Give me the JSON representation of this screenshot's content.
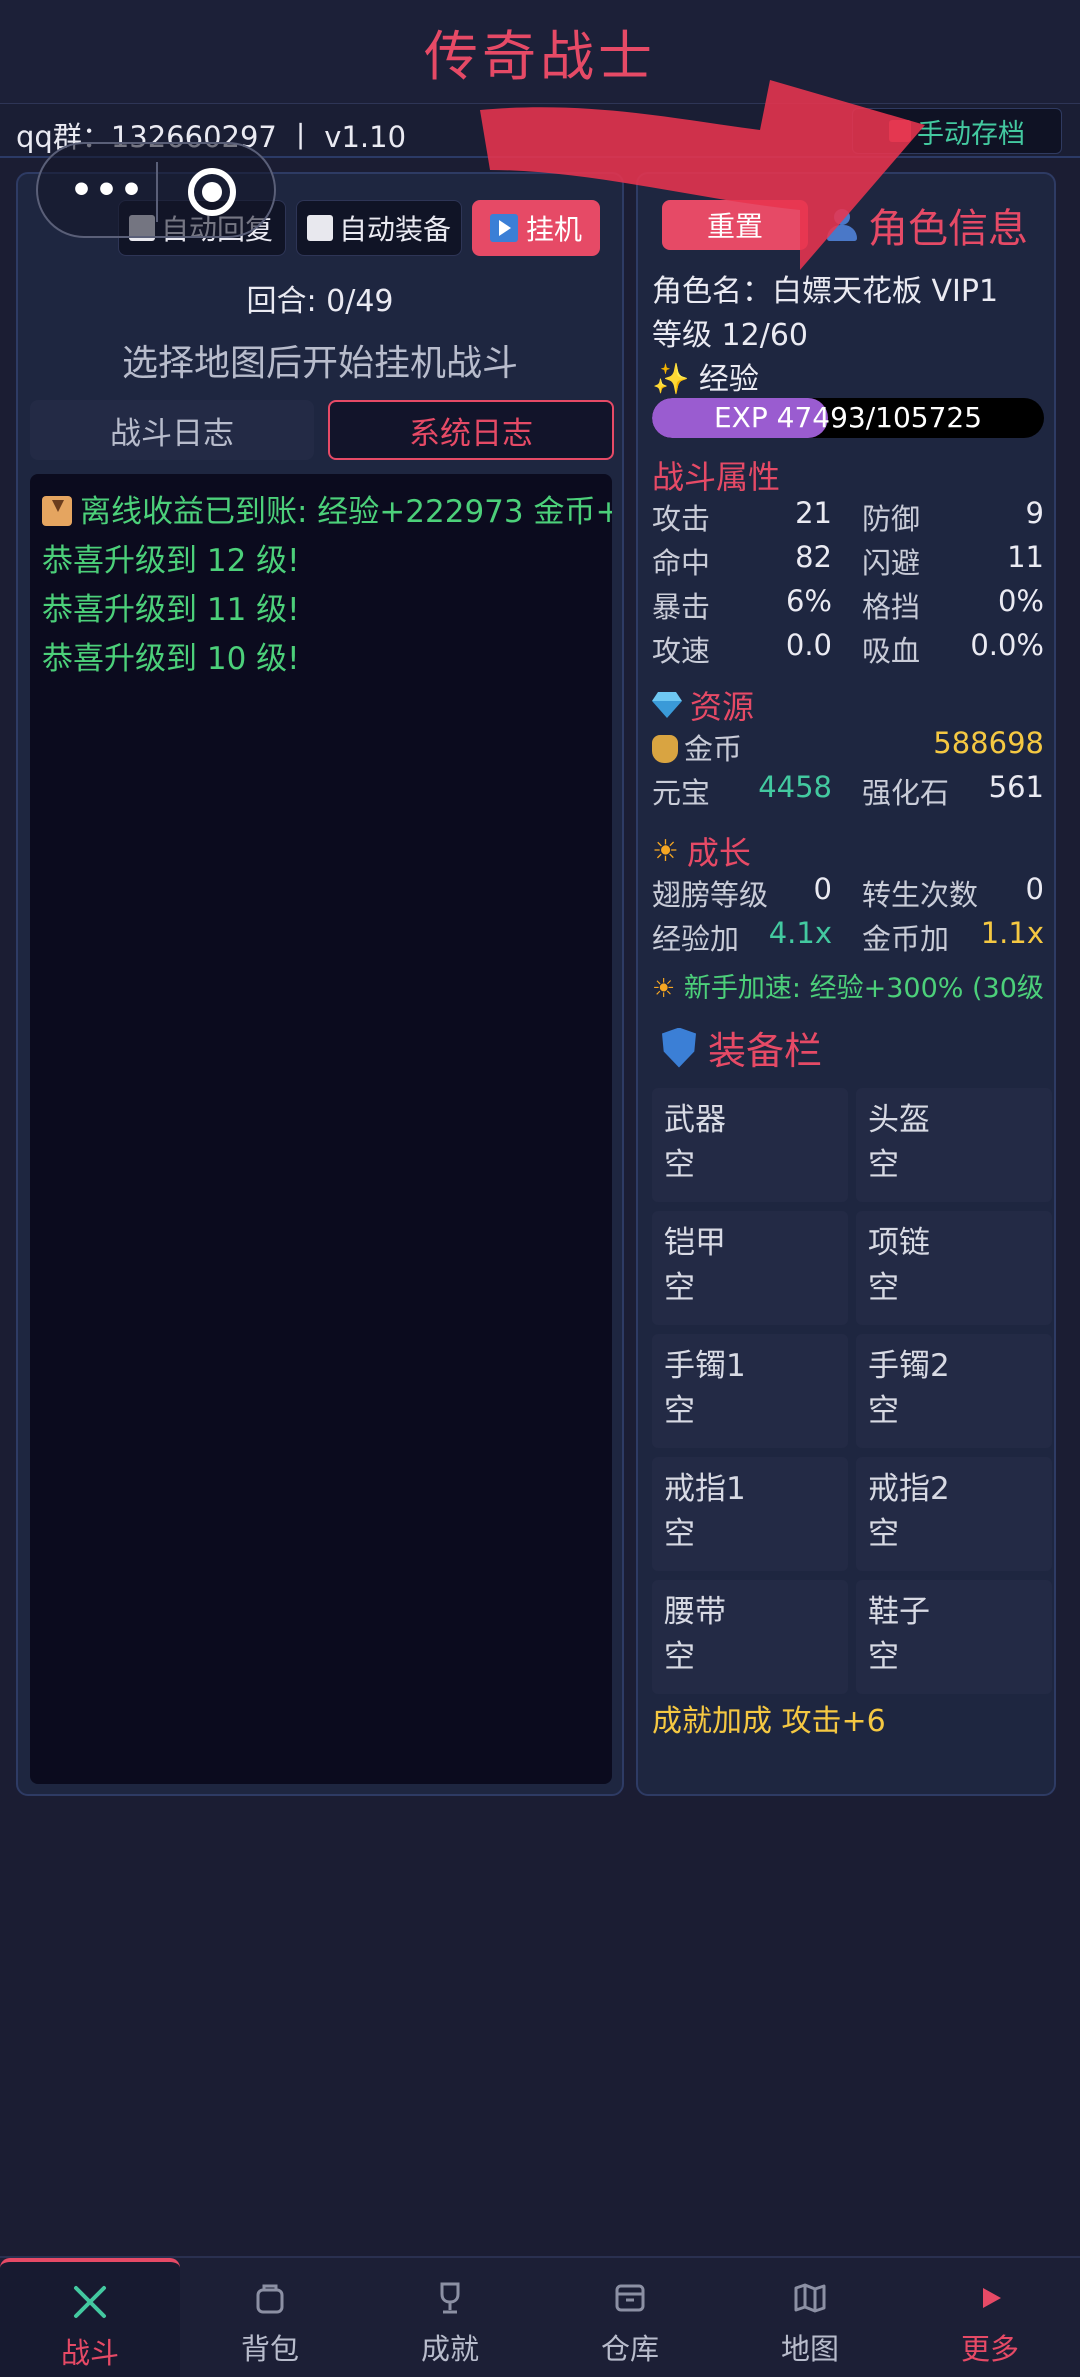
{
  "header": {
    "title": "传奇战士",
    "qq_group": "qq群：132660297 丨 v1.10",
    "save_label": "手动存档"
  },
  "capsule": {
    "more": "•••"
  },
  "battle": {
    "auto_recover": "自动回复",
    "auto_equip": "自动装备",
    "idle_label": "挂机",
    "round": "回合: 0/49",
    "hint": "选择地图后开始挂机战斗",
    "tabs": {
      "battle_log": "战斗日志",
      "system_log": "系统日志"
    },
    "logs": [
      "离线收益已到账: 经验+222973 金币+",
      "恭喜升级到 12 级!",
      "恭喜升级到 11 级!",
      "恭喜升级到 10 级!"
    ]
  },
  "character": {
    "reset_label": "重置",
    "section_title": "角色信息",
    "name": "角色名：白嫖天花板  VIP1",
    "level": "等级  12/60",
    "exp_label": "经验",
    "exp_text": "EXP 47493/105725",
    "exp_fraction": 0.449
  },
  "combat": {
    "title": "战斗属性",
    "rows": [
      {
        "l1": "攻击",
        "v1": "21",
        "l2": "防御",
        "v2": "9"
      },
      {
        "l1": "命中",
        "v1": "82",
        "l2": "闪避",
        "v2": "11"
      },
      {
        "l1": "暴击",
        "v1": "6%",
        "l2": "格挡",
        "v2": "0%"
      },
      {
        "l1": "攻速",
        "v1": "0.0",
        "l2": "吸血",
        "v2": "0.0%"
      }
    ]
  },
  "resources": {
    "title": "资源",
    "gold_label": "金币",
    "gold": "588698",
    "yuanbao_label": "元宝",
    "yuanbao": "4458",
    "stone_label": "强化石",
    "stone": "561"
  },
  "growth": {
    "title": "成长",
    "wing_label": "翅膀等级",
    "wing": "0",
    "rebirth_label": "转生次数",
    "rebirth": "0",
    "exp_bonus_label": "经验加",
    "exp_bonus": "4.1x",
    "gold_bonus_label": "金币加",
    "gold_bonus": "1.1x",
    "newbie": "新手加速: 经验+300% (30级"
  },
  "equipment": {
    "title": "装备栏",
    "slots": [
      {
        "name": "武器",
        "value": "空"
      },
      {
        "name": "头盔",
        "value": "空"
      },
      {
        "name": "铠甲",
        "value": "空"
      },
      {
        "name": "项链",
        "value": "空"
      },
      {
        "name": "手镯1",
        "value": "空"
      },
      {
        "name": "手镯2",
        "value": "空"
      },
      {
        "name": "戒指1",
        "value": "空"
      },
      {
        "name": "戒指2",
        "value": "空"
      },
      {
        "name": "腰带",
        "value": "空"
      },
      {
        "name": "鞋子",
        "value": "空"
      }
    ],
    "achievement": "成就加成 攻击+6"
  },
  "nav": {
    "items": [
      "战斗",
      "背包",
      "成就",
      "仓库",
      "地图",
      "更多"
    ]
  },
  "colors": {
    "accent": "#e64a66",
    "background": "#1b1d33",
    "panel": "#1e2640",
    "log_green": "#4cd07a",
    "gold": "#f5c842",
    "teal": "#43c9a0",
    "exp_purple": "#9a5cd0"
  }
}
